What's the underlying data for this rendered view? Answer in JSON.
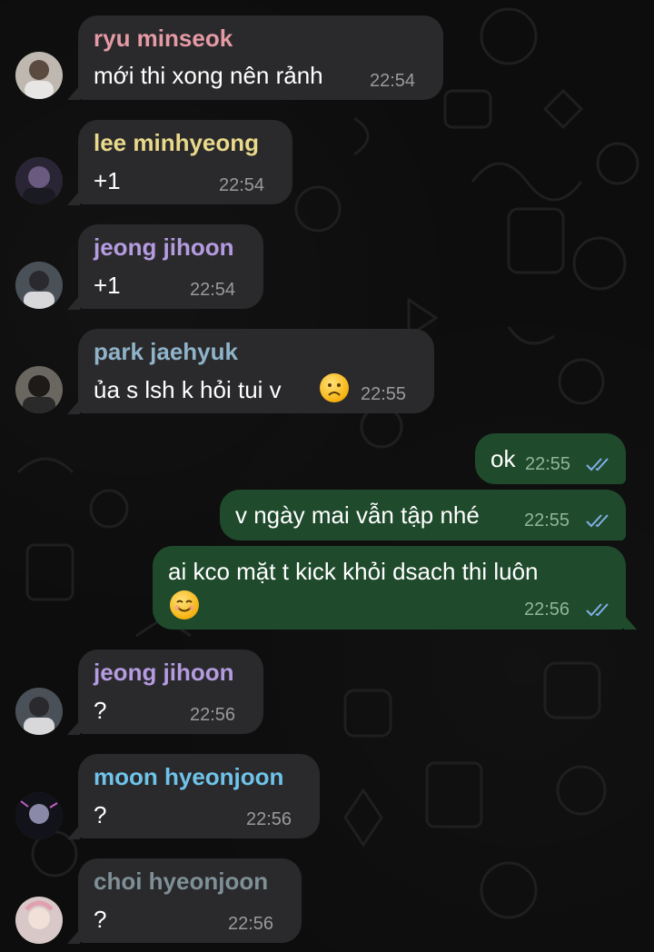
{
  "messages": [
    {
      "id": "m1",
      "sender": "ryu minseok",
      "sender_color": "#e59aa5",
      "text": "mới thi xong nên rảnh",
      "time": "22:54",
      "avatar": "avatar-ryu-minseok"
    },
    {
      "id": "m2",
      "sender": "lee minhyeong",
      "sender_color": "#e9d98a",
      "text": "+1",
      "time": "22:54",
      "avatar": "avatar-lee-minhyeong"
    },
    {
      "id": "m3",
      "sender": "jeong jihoon",
      "sender_color": "#b59be0",
      "text": "+1",
      "time": "22:54",
      "avatar": "avatar-jeong-jihoon"
    },
    {
      "id": "m4",
      "sender": "park jaehyuk",
      "sender_color": "#8fb3c9",
      "text": "ủa s lsh k hỏi tui v",
      "emoji": "frowning-face-emoji",
      "time": "22:55",
      "avatar": "avatar-park-jaehyuk"
    },
    {
      "id": "o1",
      "text": "ok",
      "time": "22:55",
      "status": "read"
    },
    {
      "id": "o2",
      "text": "v ngày mai vẫn tập nhé",
      "time": "22:55",
      "status": "read"
    },
    {
      "id": "o3",
      "text": "ai kco mặt t kick khỏi dsach thi luôn",
      "emoji": "smiling-face-emoji",
      "time": "22:56",
      "status": "read"
    },
    {
      "id": "m5",
      "sender": "jeong jihoon",
      "sender_color": "#b59be0",
      "text": "?",
      "time": "22:56",
      "avatar": "avatar-jeong-jihoon"
    },
    {
      "id": "m6",
      "sender": "moon hyeonjoon",
      "sender_color": "#6fc3ea",
      "text": "?",
      "time": "22:56",
      "avatar": "avatar-moon-hyeonjoon"
    },
    {
      "id": "m7",
      "sender": "choi hyeonjoon",
      "sender_color": "#7f9097",
      "text": "?",
      "time": "22:56",
      "avatar": "avatar-choi-hyeonjoon"
    }
  ],
  "colors": {
    "incoming_bubble": "#2a2a2c",
    "outgoing_bubble": "#1f4a2c",
    "read_check": "#7fb0e6",
    "timestamp": "#9a9a9d"
  }
}
